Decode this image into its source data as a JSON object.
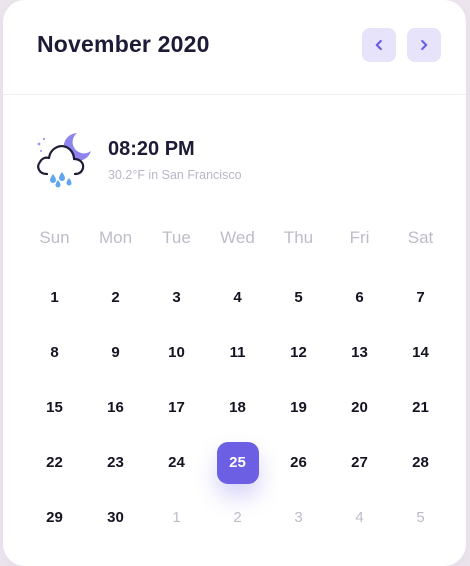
{
  "header": {
    "title": "November 2020",
    "prev_icon": "chevron-left-icon",
    "next_icon": "chevron-right-icon",
    "accent_color": "#6c5fe4",
    "button_bg": "#e6e3fa"
  },
  "weather": {
    "icon": "night-rain-cloud-icon",
    "time": "08:20 PM",
    "temperature": "30.2°F in San Francisco"
  },
  "weekdays": [
    "Sun",
    "Mon",
    "Tue",
    "Wed",
    "Thu",
    "Fri",
    "Sat"
  ],
  "days": [
    {
      "label": "1",
      "muted": false,
      "selected": false
    },
    {
      "label": "2",
      "muted": false,
      "selected": false
    },
    {
      "label": "3",
      "muted": false,
      "selected": false
    },
    {
      "label": "4",
      "muted": false,
      "selected": false
    },
    {
      "label": "5",
      "muted": false,
      "selected": false
    },
    {
      "label": "6",
      "muted": false,
      "selected": false
    },
    {
      "label": "7",
      "muted": false,
      "selected": false
    },
    {
      "label": "8",
      "muted": false,
      "selected": false
    },
    {
      "label": "9",
      "muted": false,
      "selected": false
    },
    {
      "label": "10",
      "muted": false,
      "selected": false
    },
    {
      "label": "11",
      "muted": false,
      "selected": false
    },
    {
      "label": "12",
      "muted": false,
      "selected": false
    },
    {
      "label": "13",
      "muted": false,
      "selected": false
    },
    {
      "label": "14",
      "muted": false,
      "selected": false
    },
    {
      "label": "15",
      "muted": false,
      "selected": false
    },
    {
      "label": "16",
      "muted": false,
      "selected": false
    },
    {
      "label": "17",
      "muted": false,
      "selected": false
    },
    {
      "label": "18",
      "muted": false,
      "selected": false
    },
    {
      "label": "19",
      "muted": false,
      "selected": false
    },
    {
      "label": "20",
      "muted": false,
      "selected": false
    },
    {
      "label": "21",
      "muted": false,
      "selected": false
    },
    {
      "label": "22",
      "muted": false,
      "selected": false
    },
    {
      "label": "23",
      "muted": false,
      "selected": false
    },
    {
      "label": "24",
      "muted": false,
      "selected": false
    },
    {
      "label": "25",
      "muted": false,
      "selected": true
    },
    {
      "label": "26",
      "muted": false,
      "selected": false
    },
    {
      "label": "27",
      "muted": false,
      "selected": false
    },
    {
      "label": "28",
      "muted": false,
      "selected": false
    },
    {
      "label": "29",
      "muted": false,
      "selected": false
    },
    {
      "label": "30",
      "muted": false,
      "selected": false
    },
    {
      "label": "1",
      "muted": true,
      "selected": false
    },
    {
      "label": "2",
      "muted": true,
      "selected": false
    },
    {
      "label": "3",
      "muted": true,
      "selected": false
    },
    {
      "label": "4",
      "muted": true,
      "selected": false
    },
    {
      "label": "5",
      "muted": true,
      "selected": false
    }
  ]
}
